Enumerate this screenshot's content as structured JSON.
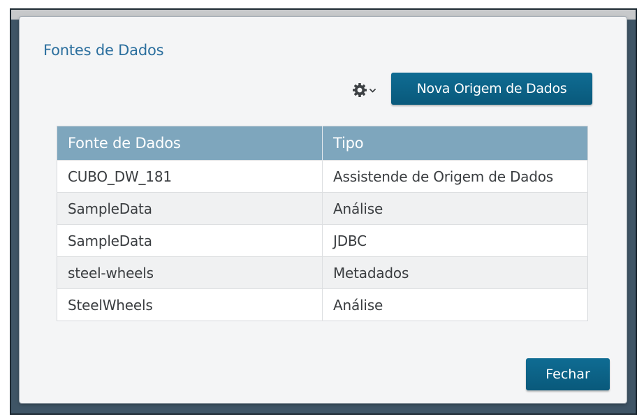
{
  "dialog": {
    "title": "Fontes de Dados",
    "new_button_label": "Nova Origem de Dados",
    "close_button_label": "Fechar"
  },
  "toolbar": {
    "settings_icon": "gear-icon",
    "dropdown_icon": "chevron-down-icon"
  },
  "table": {
    "columns": [
      "Fonte de Dados",
      "Tipo"
    ],
    "rows": [
      [
        "CUBO_DW_181",
        "Assistende de Origem de Dados"
      ],
      [
        "SampleData",
        "Análise"
      ],
      [
        "SampleData",
        "JDBC"
      ],
      [
        "steel-wheels",
        "Metadados"
      ],
      [
        "SteelWheels",
        "Análise"
      ]
    ]
  },
  "colors": {
    "title": "#2b6f9e",
    "primary_button": "#0b6285",
    "table_header": "#7ea6bd",
    "backdrop": "#3f5566"
  }
}
